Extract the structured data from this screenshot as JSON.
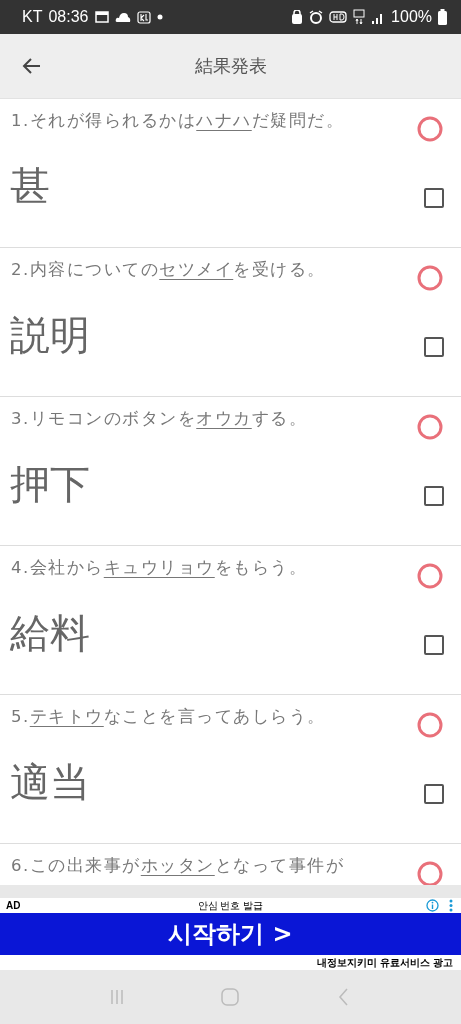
{
  "status_bar": {
    "carrier": "KT",
    "time": "08:36",
    "battery": "100%"
  },
  "header": {
    "title": "結果発表"
  },
  "questions": [
    {
      "number": "1.",
      "before": "それが得られるかは",
      "katakana": "ハナハ",
      "after": "だ疑問だ。",
      "correct": true,
      "answer": "甚",
      "checked": false
    },
    {
      "number": "2.",
      "before": "内容についての",
      "katakana": "セツメイ",
      "after": "を受ける。",
      "correct": true,
      "answer": "説明",
      "checked": false
    },
    {
      "number": "3.",
      "before": "リモコンのボタンを",
      "katakana": "オウカ",
      "after": "する。",
      "correct": true,
      "answer": "押下",
      "checked": false
    },
    {
      "number": "4.",
      "before": "会社から",
      "katakana": "キュウリョウ",
      "after": "をもらう。",
      "correct": true,
      "answer": "給料",
      "checked": false
    },
    {
      "number": "5.",
      "katakana": "テキトウ",
      "after": "なことを言ってあしらう。",
      "correct": true,
      "answer": "適当",
      "checked": false
    },
    {
      "number": "6.",
      "before": "この出来事が",
      "katakana": "ホッタン",
      "after": "となって事件が",
      "correct": true
    }
  ],
  "ad": {
    "label": "AD",
    "headline": "안심 번호 발급",
    "cta": "시작하기 >",
    "footer": "내정보지키미 유료서비스 광고"
  }
}
